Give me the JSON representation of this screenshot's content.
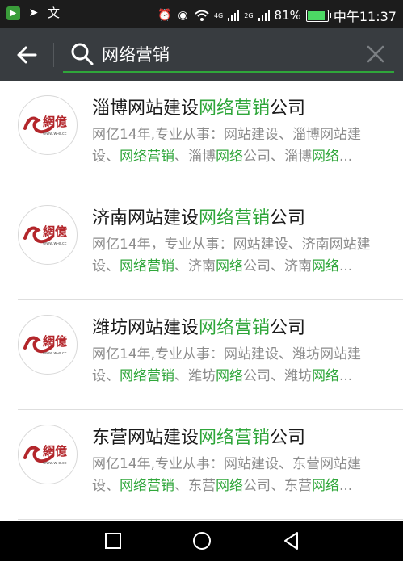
{
  "status_bar": {
    "battery": "81%",
    "time": "中午11:37",
    "network_1": "4G",
    "network_2": "2G",
    "icons_left": [
      "app-icon",
      "send-icon",
      "text-app-icon"
    ],
    "icons_right": [
      "alarm-icon",
      "eye-icon",
      "wifi-icon",
      "signal-icon",
      "signal-icon",
      "battery-icon"
    ]
  },
  "search": {
    "query": "网络营销",
    "back_icon": "arrow-left-icon",
    "search_icon": "magnifier-icon",
    "clear_icon": "close-icon"
  },
  "colors": {
    "accent": "#2fa63a",
    "header_bg": "#383c40",
    "statusbar_bg": "#1c1c1c",
    "logo_red": "#b3262b"
  },
  "logo_text": {
    "brand": "網億",
    "domain": "www.w-e.cc"
  },
  "results": [
    {
      "title_pre": "淄博网站建设",
      "title_hl": "网络营销",
      "title_post": "公司",
      "l1": "网亿14年,专业从事：网站建设、淄博网站建",
      "l2_a": "设、",
      "l2_b": "网络营销",
      "l2_c": "、淄博",
      "l2_d": "网络",
      "l2_e": "公司、淄博",
      "l2_f": "网络",
      "l2_g": "..."
    },
    {
      "title_pre": "济南网站建设",
      "title_hl": "网络营销",
      "title_post": "公司",
      "l1": "网亿14年，专业从事：网站建设、济南网站建",
      "l2_a": "设、",
      "l2_b": "网络营销",
      "l2_c": "、济南",
      "l2_d": "网络",
      "l2_e": "公司、济南",
      "l2_f": "网络",
      "l2_g": "..."
    },
    {
      "title_pre": "潍坊网站建设",
      "title_hl": "网络营销",
      "title_post": "公司",
      "l1": "网亿14年,专业从事：网站建设、潍坊网站建",
      "l2_a": "设、",
      "l2_b": "网络营销",
      "l2_c": "、潍坊",
      "l2_d": "网络",
      "l2_e": "公司、潍坊",
      "l2_f": "网络",
      "l2_g": "..."
    },
    {
      "title_pre": "东营网站建设",
      "title_hl": "网络营销",
      "title_post": "公司",
      "l1": "网亿14年,专业从事：网站建设、东营网站建",
      "l2_a": "设、",
      "l2_b": "网络营销",
      "l2_c": "、东营",
      "l2_d": "网络",
      "l2_e": "公司、东营",
      "l2_f": "网络",
      "l2_g": "..."
    }
  ],
  "nav_bar": {
    "icons": [
      "recent-apps-icon",
      "home-icon",
      "back-triangle-icon"
    ]
  }
}
